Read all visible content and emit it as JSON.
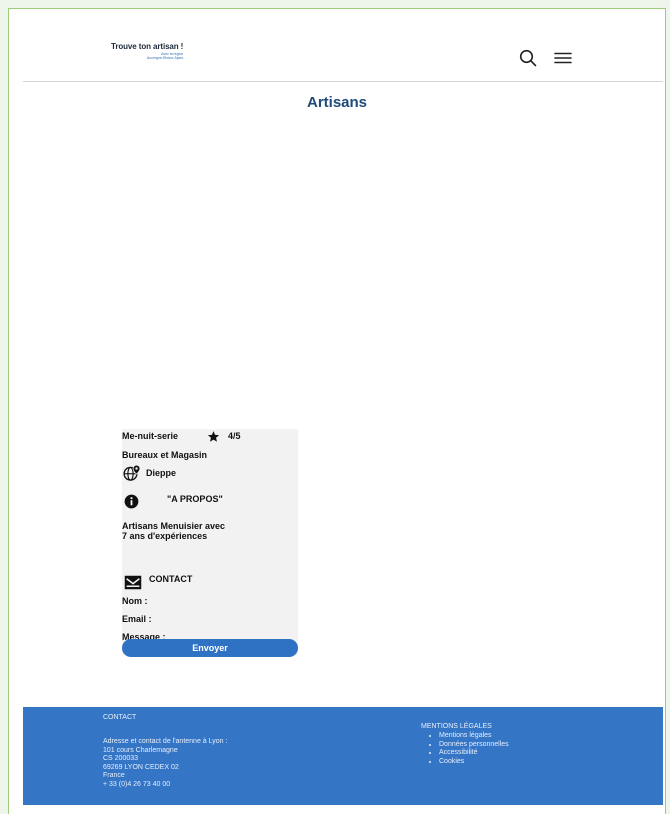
{
  "header": {
    "logo_title": "Trouve ton artisan !",
    "logo_sub_line1": "Avec la région",
    "logo_sub_line2": "Auvergne-Rhône-Alpes"
  },
  "page_title": "Artisans",
  "card": {
    "name": "Me-nuit-serie",
    "rating": "4/5",
    "category": "Bureaux et Magasin",
    "city": "Dieppe",
    "about_heading": "\"A PROPOS\"",
    "about_line1": "Artisans Menuisier avec",
    "about_line2": "7 ans d'expériences",
    "contact_heading": "CONTACT",
    "name_label": "Nom :",
    "email_label": "Email :",
    "message_label": "Message :",
    "send_label": "Envoyer"
  },
  "footer": {
    "contact_heading": "CONTACT",
    "address_lines": [
      "Adresse et contact de l'antenne à Lyon :",
      "101 cours Charlemagne",
      "CS 200033",
      "69269 LYON CEDEX 02",
      "France",
      "+ 33 (0)4 26 73 40 00"
    ],
    "legal_heading": "MENTIONS LÉGALES",
    "legal_links": [
      "Mentions légales",
      "Données personnelles",
      "Accessibilité",
      "Cookies"
    ]
  },
  "colors": {
    "accent": "#2f72c4",
    "footer_bg": "#3575c6",
    "title": "#1f4b7a",
    "card_bg": "#f2f2f2"
  },
  "icons": [
    "search-icon",
    "menu-icon",
    "star-icon",
    "globe-pin-icon",
    "info-icon",
    "mail-icon"
  ]
}
